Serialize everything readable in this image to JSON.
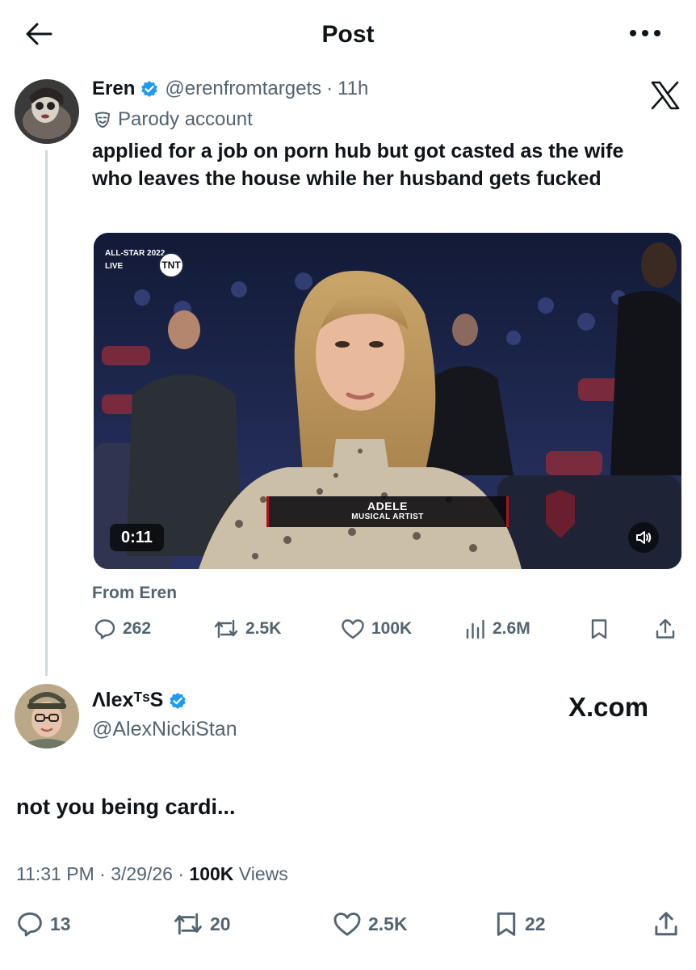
{
  "header": {
    "title": "Post"
  },
  "quoted_post": {
    "author_name": "Eren",
    "handle": "@erenfromtargets",
    "separator": "·",
    "time": "11h",
    "label": "Parody account",
    "text": "applied for a job on porn hub but got casted as the wife who leaves the house while her husband gets fucked",
    "video": {
      "duration": "0:11",
      "badge_event": "ALL-STAR 2022",
      "badge_live": "LIVE",
      "badge_network": "TNT",
      "lower_third_name": "ADELE",
      "lower_third_title": "MUSICAL ARTIST"
    },
    "attribution": "From Eren",
    "stats": {
      "replies": "262",
      "reposts": "2.5K",
      "likes": "100K",
      "views": "2.6M"
    }
  },
  "reply_post": {
    "author_name": "ɅlexᵀˢS",
    "handle": "@AlexNickiStan",
    "watermark": "X.com",
    "text": "not you being cardi...",
    "meta": {
      "time": "11:31 PM",
      "separator": "·",
      "date": "3/29/26",
      "views_count": "100K",
      "views_label": "Views"
    },
    "stats": {
      "replies": "13",
      "reposts": "20",
      "likes": "2.5K",
      "bookmarks": "22"
    }
  },
  "colors": {
    "verified": "#1d9bf0",
    "muted_text": "#536471",
    "primary_text": "#0f1419",
    "thread_line": "#cfd9de"
  },
  "icons": [
    "back-arrow-icon",
    "more-icon",
    "x-logo-icon",
    "verified-badge-icon",
    "parody-mask-icon",
    "reply-icon",
    "repost-icon",
    "like-icon",
    "views-icon",
    "bookmark-icon",
    "share-icon",
    "volume-icon"
  ]
}
